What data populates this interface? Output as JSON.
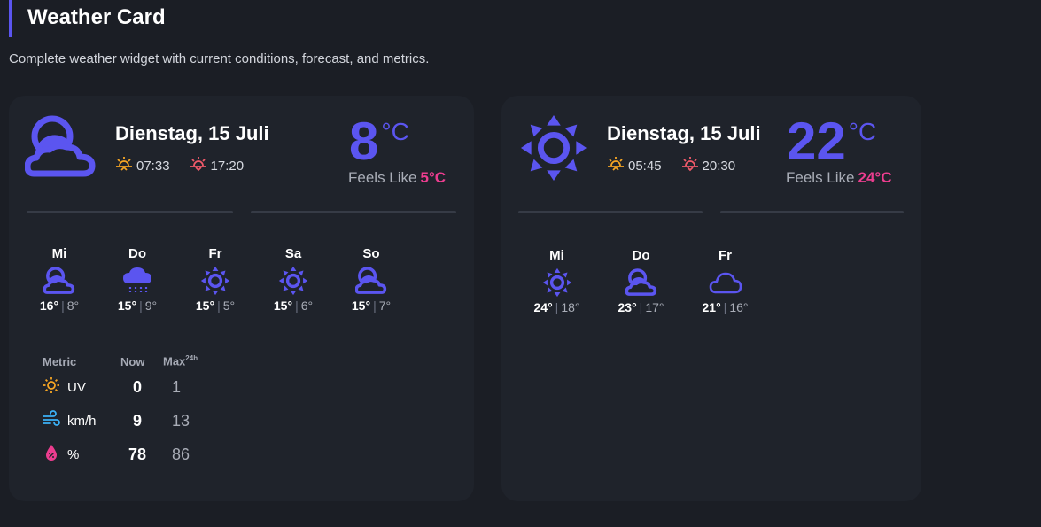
{
  "page": {
    "title": "Weather Card",
    "description": "Complete weather widget with current conditions, forecast, and metrics."
  },
  "colors": {
    "accent": "#5b55f0",
    "feels": "#ec3d8f",
    "sunrise": "#f5a524",
    "sunset": "#f05a6a",
    "wind": "#3bb0f5",
    "humidity": "#ec3d8f"
  },
  "cards": [
    {
      "icon": "partly-cloudy-icon",
      "date": "Dienstag, 15 Juli",
      "sunrise": "07:33",
      "sunset": "17:20",
      "temp": "8",
      "unit": "°C",
      "feels_label": "Feels Like",
      "feels_value": "5°C",
      "forecast": [
        {
          "day": "Mi",
          "icon": "partly-cloudy-icon",
          "hi": "16°",
          "lo": "8°"
        },
        {
          "day": "Do",
          "icon": "rain-icon",
          "hi": "15°",
          "lo": "9°"
        },
        {
          "day": "Fr",
          "icon": "sun-icon",
          "hi": "15°",
          "lo": "5°"
        },
        {
          "day": "Sa",
          "icon": "sun-icon",
          "hi": "15°",
          "lo": "6°"
        },
        {
          "day": "So",
          "icon": "partly-cloudy-icon",
          "hi": "15°",
          "lo": "7°"
        }
      ],
      "metrics": {
        "header": {
          "metric": "Metric",
          "now": "Now",
          "max": "Max",
          "max_sup": "24h"
        },
        "rows": [
          {
            "icon": "uv-icon",
            "label": "UV",
            "now": "0",
            "max": "1"
          },
          {
            "icon": "wind-icon",
            "label": "km/h",
            "now": "9",
            "max": "13"
          },
          {
            "icon": "humidity-icon",
            "label": "%",
            "now": "78",
            "max": "86"
          }
        ]
      }
    },
    {
      "icon": "sun-icon",
      "date": "Dienstag, 15 Juli",
      "sunrise": "05:45",
      "sunset": "20:30",
      "temp": "22",
      "unit": "°C",
      "feels_label": "Feels Like",
      "feels_value": "24°C",
      "forecast": [
        {
          "day": "Mi",
          "icon": "sun-icon",
          "hi": "24°",
          "lo": "18°"
        },
        {
          "day": "Do",
          "icon": "partly-cloudy-icon",
          "hi": "23°",
          "lo": "17°"
        },
        {
          "day": "Fr",
          "icon": "cloud-icon",
          "hi": "21°",
          "lo": "16°"
        }
      ]
    }
  ]
}
